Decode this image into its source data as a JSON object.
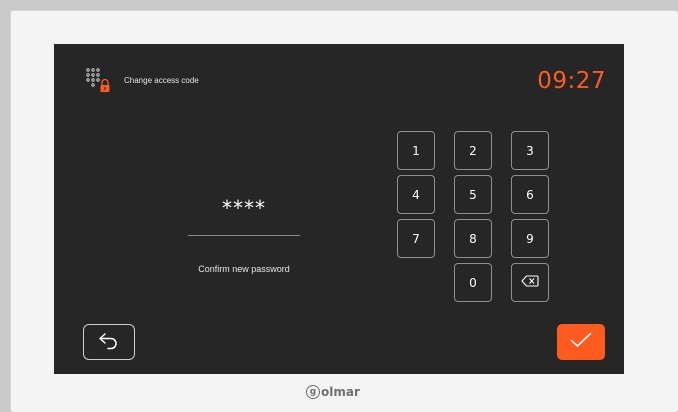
{
  "header": {
    "icon": "keypad-lock-icon",
    "title": "Change access code",
    "clock": "09:27"
  },
  "code_entry": {
    "masked_value": "****",
    "prompt": "Confirm new password"
  },
  "keypad": {
    "keys": [
      "1",
      "2",
      "3",
      "4",
      "5",
      "6",
      "7",
      "8",
      "9",
      "0"
    ],
    "backspace_icon": "backspace-icon"
  },
  "footer": {
    "back_icon": "back-arrow-icon",
    "confirm_icon": "checkmark-icon"
  },
  "device": {
    "brand_mark": "g",
    "brand_name": "olmar"
  },
  "colors": {
    "accent": "#ff5a1f",
    "screen_bg": "#262626",
    "bezel": "#f4f4f4"
  }
}
